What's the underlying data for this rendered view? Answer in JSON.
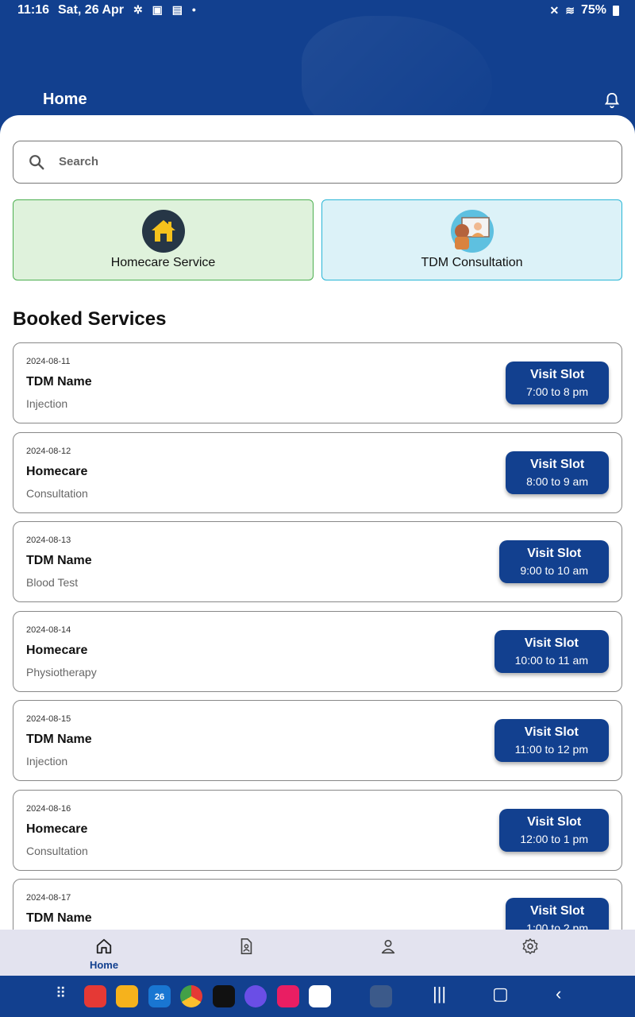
{
  "status_bar": {
    "time": "11:16",
    "date": "Sat, 26 Apr",
    "battery": "75%"
  },
  "header": {
    "title": "Home"
  },
  "search": {
    "placeholder": "Search"
  },
  "tiles": [
    {
      "label": "Homecare Service",
      "icon": "house-icon"
    },
    {
      "label": "TDM Consultation",
      "icon": "doctor-icon"
    }
  ],
  "section_title": "Booked Services",
  "bookings": [
    {
      "date": "2024-08-11",
      "name": "TDM Name",
      "service": "Injection",
      "slot_title": "Visit Slot",
      "slot_time": "7:00 to 8 pm"
    },
    {
      "date": "2024-08-12",
      "name": "Homecare",
      "service": "Consultation",
      "slot_title": "Visit Slot",
      "slot_time": "8:00 to 9 am"
    },
    {
      "date": "2024-08-13",
      "name": "TDM Name",
      "service": "Blood Test",
      "slot_title": "Visit Slot",
      "slot_time": "9:00 to 10 am"
    },
    {
      "date": "2024-08-14",
      "name": "Homecare",
      "service": "Physiotherapy",
      "slot_title": "Visit Slot",
      "slot_time": "10:00 to 11 am"
    },
    {
      "date": "2024-08-15",
      "name": "TDM Name",
      "service": "Injection",
      "slot_title": "Visit Slot",
      "slot_time": "11:00 to 12 pm"
    },
    {
      "date": "2024-08-16",
      "name": "Homecare",
      "service": "Consultation",
      "slot_title": "Visit Slot",
      "slot_time": "12:00 to 1 pm"
    },
    {
      "date": "2024-08-17",
      "name": "TDM Name",
      "service": "",
      "slot_title": "Visit Slot",
      "slot_time": "1:00 to 2 pm"
    }
  ],
  "bottom_nav": [
    {
      "label": "Home",
      "icon": "home-icon",
      "active": true
    },
    {
      "label": "",
      "icon": "document-icon"
    },
    {
      "label": "",
      "icon": "profile-icon"
    },
    {
      "label": "",
      "icon": "settings-icon"
    }
  ],
  "calendar_day": "26",
  "colors": {
    "primary": "#12408f",
    "homecare_tile": "#dff2dc",
    "tdm_tile": "#dcf2f8"
  }
}
